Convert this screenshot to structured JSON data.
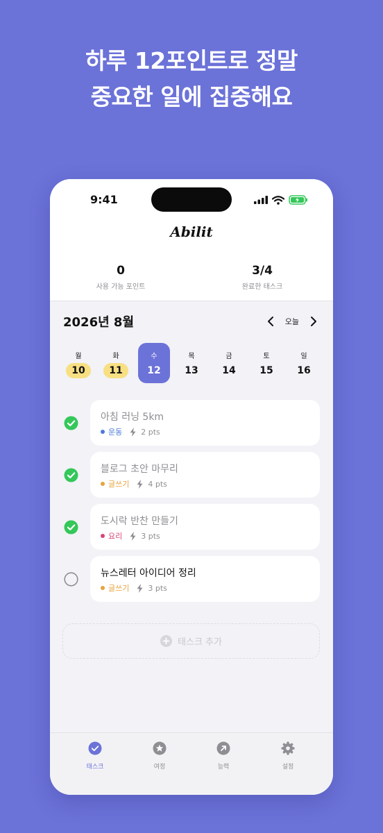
{
  "headline": {
    "line1": "하루 12포인트로 정말",
    "line2": "중요한 일에 집중해요"
  },
  "status_bar": {
    "time": "9:41"
  },
  "app": {
    "title": "Abilit"
  },
  "stats": [
    {
      "value": "0",
      "label": "사용 가능 포인트"
    },
    {
      "value": "3/4",
      "label": "완료한 태스크"
    }
  ],
  "calendar": {
    "month_title": "2026년 8월",
    "today_label": "오늘",
    "days": [
      {
        "name": "월",
        "num": "10",
        "marked": true,
        "selected": false
      },
      {
        "name": "화",
        "num": "11",
        "marked": true,
        "selected": false
      },
      {
        "name": "수",
        "num": "12",
        "marked": false,
        "selected": true
      },
      {
        "name": "목",
        "num": "13",
        "marked": false,
        "selected": false
      },
      {
        "name": "금",
        "num": "14",
        "marked": false,
        "selected": false
      },
      {
        "name": "토",
        "num": "15",
        "marked": false,
        "selected": false
      },
      {
        "name": "일",
        "num": "16",
        "marked": false,
        "selected": false
      }
    ]
  },
  "tasks": [
    {
      "title": "아침 러닝 5km",
      "category": "운동",
      "category_color": "#4A7BD8",
      "points": "2 pts",
      "done": true
    },
    {
      "title": "블로그 초안 마무리",
      "category": "글쓰기",
      "category_color": "#E8A33D",
      "points": "4 pts",
      "done": true
    },
    {
      "title": "도시락 반찬 만들기",
      "category": "요리",
      "category_color": "#D6457A",
      "points": "3 pts",
      "done": true
    },
    {
      "title": "뉴스레터 아이디어 정리",
      "category": "글쓰기",
      "category_color": "#E8A33D",
      "points": "3 pts",
      "done": false
    }
  ],
  "add_task_label": "태스크 추가",
  "tabs": [
    {
      "label": "태스크",
      "icon": "check-circle-icon",
      "active": true
    },
    {
      "label": "여정",
      "icon": "star-icon",
      "active": false
    },
    {
      "label": "능력",
      "icon": "arrow-up-right-icon",
      "active": false
    },
    {
      "label": "설정",
      "icon": "gear-icon",
      "active": false
    }
  ],
  "colors": {
    "background": "#6B72D8",
    "accent": "#6B72D8",
    "done_check": "#34C759",
    "marked_day": "#F8DF82"
  }
}
